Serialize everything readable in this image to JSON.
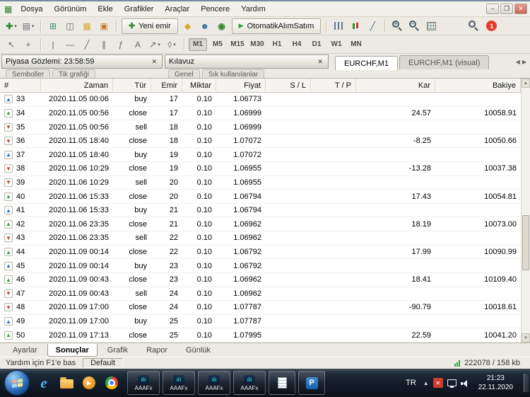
{
  "window": {
    "menu_items": [
      "Dosya",
      "Görünüm",
      "Ekle",
      "Grafikler",
      "Araçlar",
      "Pencere",
      "Yardım"
    ]
  },
  "toolbar": {
    "new_order_label": "Yeni emir",
    "autotrade_label": "OtomatikAlımSatım",
    "alert_badge": "1"
  },
  "timeframes": [
    "M1",
    "M5",
    "M15",
    "M30",
    "H1",
    "H4",
    "D1",
    "W1",
    "MN"
  ],
  "active_timeframe": "M1",
  "panels": {
    "market_watch_title": "Piyasa Gözlemi: 23:58:59",
    "market_watch_tabs": [
      "Semboller",
      "Tik grafiği"
    ],
    "navigator_title": "Kılavuz",
    "navigator_tabs": [
      "Genel",
      "Sık kullanılanlar"
    ]
  },
  "chart_tabs": [
    {
      "label": "EURCHF,M1",
      "active": true
    },
    {
      "label": "EURCHF,M1 (visual)",
      "active": false
    }
  ],
  "table": {
    "columns": [
      "#",
      "Zaman",
      "Tür",
      "Emir",
      "Miktar",
      "Fiyat",
      "S / L",
      "T / P",
      "Kar",
      "Bakiye"
    ],
    "rows": [
      {
        "icon": "buy",
        "num": "33",
        "time": "2020.11.05 00:06",
        "type": "buy",
        "order": "17",
        "size": "0.10",
        "price": "1.06773",
        "sl": "",
        "tp": "",
        "profit": "",
        "balance": ""
      },
      {
        "icon": "close_p",
        "num": "34",
        "time": "2020.11.05 00:56",
        "type": "close",
        "order": "17",
        "size": "0.10",
        "price": "1.06999",
        "sl": "",
        "tp": "",
        "profit": "24.57",
        "balance": "10058.91"
      },
      {
        "icon": "sell",
        "num": "35",
        "time": "2020.11.05 00:56",
        "type": "sell",
        "order": "18",
        "size": "0.10",
        "price": "1.06999",
        "sl": "",
        "tp": "",
        "profit": "",
        "balance": ""
      },
      {
        "icon": "close_l",
        "num": "36",
        "time": "2020.11.05 18:40",
        "type": "close",
        "order": "18",
        "size": "0.10",
        "price": "1.07072",
        "sl": "",
        "tp": "",
        "profit": "-8.25",
        "balance": "10050.66"
      },
      {
        "icon": "buy",
        "num": "37",
        "time": "2020.11.05 18:40",
        "type": "buy",
        "order": "19",
        "size": "0.10",
        "price": "1.07072",
        "sl": "",
        "tp": "",
        "profit": "",
        "balance": ""
      },
      {
        "icon": "close_l",
        "num": "38",
        "time": "2020.11.06 10:29",
        "type": "close",
        "order": "19",
        "size": "0.10",
        "price": "1.06955",
        "sl": "",
        "tp": "",
        "profit": "-13.28",
        "balance": "10037.38"
      },
      {
        "icon": "sell",
        "num": "39",
        "time": "2020.11.06 10:29",
        "type": "sell",
        "order": "20",
        "size": "0.10",
        "price": "1.06955",
        "sl": "",
        "tp": "",
        "profit": "",
        "balance": ""
      },
      {
        "icon": "close_p",
        "num": "40",
        "time": "2020.11.06 15:33",
        "type": "close",
        "order": "20",
        "size": "0.10",
        "price": "1.06794",
        "sl": "",
        "tp": "",
        "profit": "17.43",
        "balance": "10054.81"
      },
      {
        "icon": "buy",
        "num": "41",
        "time": "2020.11.06 15:33",
        "type": "buy",
        "order": "21",
        "size": "0.10",
        "price": "1.06794",
        "sl": "",
        "tp": "",
        "profit": "",
        "balance": ""
      },
      {
        "icon": "close_p",
        "num": "42",
        "time": "2020.11.06 23:35",
        "type": "close",
        "order": "21",
        "size": "0.10",
        "price": "1.06962",
        "sl": "",
        "tp": "",
        "profit": "18.19",
        "balance": "10073.00"
      },
      {
        "icon": "sell",
        "num": "43",
        "time": "2020.11.06 23:35",
        "type": "sell",
        "order": "22",
        "size": "0.10",
        "price": "1.06962",
        "sl": "",
        "tp": "",
        "profit": "",
        "balance": ""
      },
      {
        "icon": "close_p",
        "num": "44",
        "time": "2020.11.09 00:14",
        "type": "close",
        "order": "22",
        "size": "0.10",
        "price": "1.06792",
        "sl": "",
        "tp": "",
        "profit": "17.99",
        "balance": "10090.99"
      },
      {
        "icon": "buy",
        "num": "45",
        "time": "2020.11.09 00:14",
        "type": "buy",
        "order": "23",
        "size": "0.10",
        "price": "1.06792",
        "sl": "",
        "tp": "",
        "profit": "",
        "balance": ""
      },
      {
        "icon": "close_p",
        "num": "46",
        "time": "2020.11.09 00:43",
        "type": "close",
        "order": "23",
        "size": "0.10",
        "price": "1.06962",
        "sl": "",
        "tp": "",
        "profit": "18.41",
        "balance": "10109.40"
      },
      {
        "icon": "sell",
        "num": "47",
        "time": "2020.11.09 00:43",
        "type": "sell",
        "order": "24",
        "size": "0.10",
        "price": "1.06962",
        "sl": "",
        "tp": "",
        "profit": "",
        "balance": ""
      },
      {
        "icon": "close_l",
        "num": "48",
        "time": "2020.11.09 17:00",
        "type": "close",
        "order": "24",
        "size": "0.10",
        "price": "1.07787",
        "sl": "",
        "tp": "",
        "profit": "-90.79",
        "balance": "10018.61"
      },
      {
        "icon": "buy",
        "num": "49",
        "time": "2020.11.09 17:00",
        "type": "buy",
        "order": "25",
        "size": "0.10",
        "price": "1.07787",
        "sl": "",
        "tp": "",
        "profit": "",
        "balance": ""
      },
      {
        "icon": "close_p",
        "num": "50",
        "time": "2020.11.09 17:13",
        "type": "close",
        "order": "25",
        "size": "0.10",
        "price": "1.07995",
        "sl": "",
        "tp": "",
        "profit": "22.59",
        "balance": "10041.20"
      }
    ]
  },
  "bottom_tabs": [
    "Ayarlar",
    "Sonuçlar",
    "Grafik",
    "Rapor",
    "Günlük"
  ],
  "active_bottom_tab": "Sonuçlar",
  "status": {
    "help_text": "Yardım için F1'e bas",
    "profile": "Default",
    "traffic": "222078 / 158 kb"
  },
  "taskbar": {
    "apps": [
      {
        "label": "AAAFx"
      },
      {
        "label": "AAAFx"
      },
      {
        "label": "AAAFx"
      },
      {
        "label": "AAAFx"
      }
    ],
    "language": "TR",
    "time": "21:23",
    "date": "22.11.2020"
  },
  "colors": {
    "accent_red_badge": "#e33b2e",
    "buy_blue": "#1d6fd1",
    "sell_red": "#cf3b2f",
    "profit_green": "#2e9e44",
    "taskbar_dark": "#111b27"
  },
  "icons": {
    "app": "▦",
    "minimize": "–",
    "maximize": "❐",
    "close": "✕",
    "dropdown": "▾",
    "new_chart": "✚",
    "profiles": "▤",
    "market_watch": "⊞",
    "data_window": "◫",
    "navigator": "▦",
    "terminal": "▣",
    "new_order_plus": "✚",
    "expert": "◆",
    "community": "☻",
    "support": "◉",
    "play": "▶",
    "zoom_plus": "+",
    "zoom_minus": "–",
    "cursor": "↖",
    "crosshair": "+",
    "vline": "|",
    "hline": "—",
    "trendline": "╱",
    "channel": "∥",
    "fibo": "ƒ",
    "text_tool": "A",
    "arrows_tool": "↗",
    "shapes": "◊",
    "tab_close": "✕",
    "scroll_left": "◀",
    "scroll_right": "▶",
    "scroll_up": "▲",
    "scroll_down": "▼",
    "row_buy": "▲",
    "row_sell": "▼",
    "row_close_p": "▲",
    "row_close_l": "▼",
    "mt": "ılı",
    "program": "P",
    "tray_up": "▲",
    "tray_alert": "✕"
  }
}
